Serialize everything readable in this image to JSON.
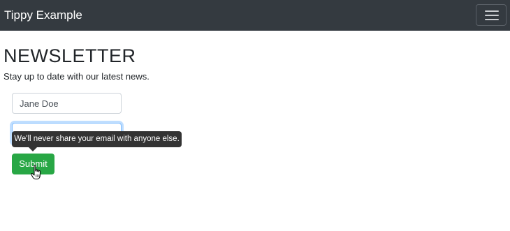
{
  "navbar": {
    "brand": "Tippy Example",
    "toggle_icon": "hamburger-icon",
    "background": "#343a40"
  },
  "main": {
    "heading": "NEWSLETTER",
    "subtitle": "Stay up to date with our latest news."
  },
  "form": {
    "name_value": "Jane Doe",
    "email_value": "",
    "submit_label": "Submit",
    "submit_color": "#28a745"
  },
  "tooltip": {
    "text": "We'll never share your email with anyone else."
  },
  "cursor": {
    "icon": "hand-pointer-icon"
  }
}
